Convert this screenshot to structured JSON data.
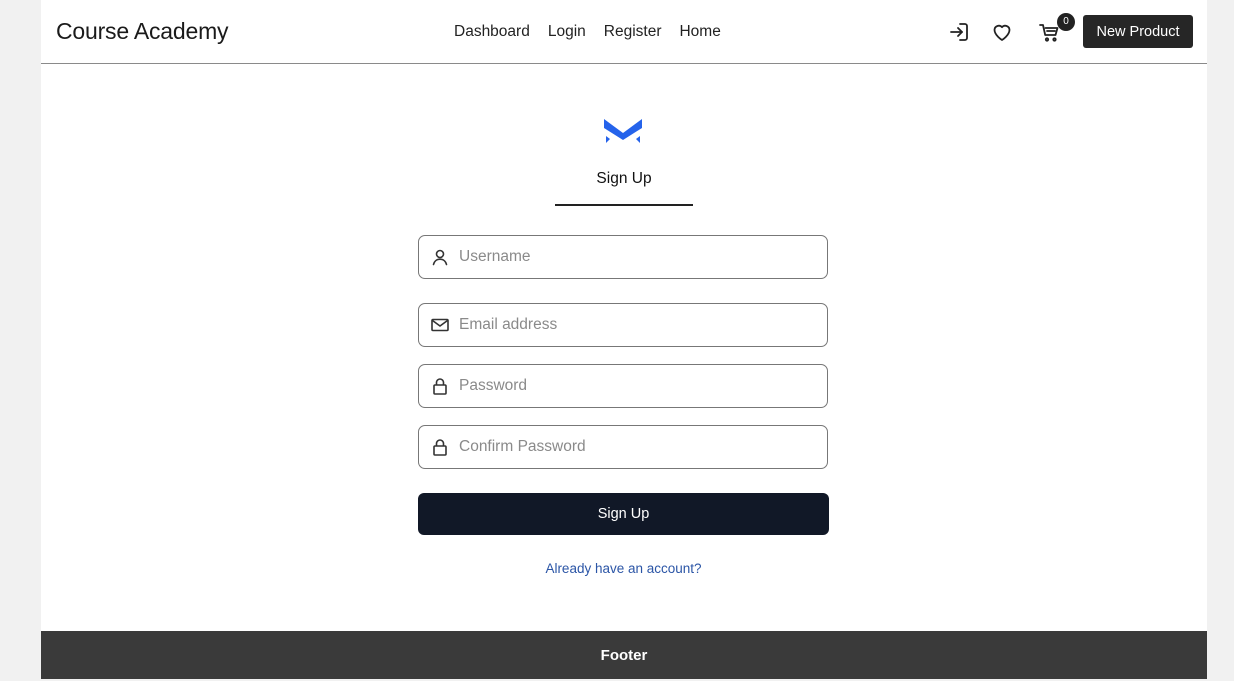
{
  "header": {
    "brand": "Course Academy",
    "nav": [
      "Dashboard",
      "Login",
      "Register",
      "Home"
    ],
    "cart_count": "0",
    "new_product_label": "New Product",
    "icons": [
      "login-icon",
      "heart-icon",
      "cart-icon"
    ]
  },
  "form": {
    "title": "Sign Up",
    "fields": [
      {
        "icon": "user-icon",
        "placeholder": "Username",
        "value": ""
      },
      {
        "icon": "mail-icon",
        "placeholder": "Email address",
        "value": ""
      },
      {
        "icon": "lock-icon",
        "placeholder": "Password",
        "value": ""
      },
      {
        "icon": "lock-icon",
        "placeholder": "Confirm Password",
        "value": ""
      }
    ],
    "submit_label": "Sign Up",
    "login_link": "Already have an account?"
  },
  "footer": {
    "text": "Footer"
  },
  "colors": {
    "logo": "#2563eb",
    "button": "#111827",
    "link": "#2b55a6",
    "footer": "#3a3a3a"
  }
}
